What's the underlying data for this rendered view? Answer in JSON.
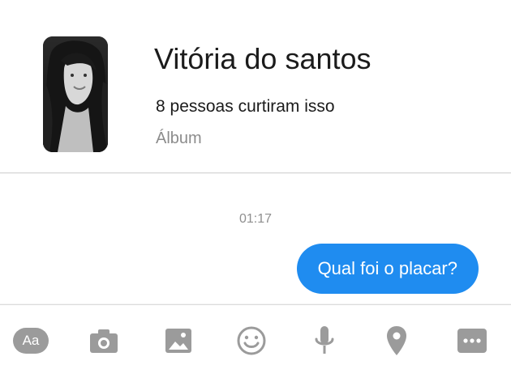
{
  "profile": {
    "name": "Vitória do santos",
    "likes": "8 pessoas curtiram isso",
    "type": "Álbum"
  },
  "conversation": {
    "timestamp": "01:17",
    "message": "Qual foi o placar?",
    "bubble_color": "#1f8cf0"
  },
  "composer": {
    "text_button_label": "Aa",
    "icons": [
      "text-format-icon",
      "camera-icon",
      "image-icon",
      "emoji-icon",
      "microphone-icon",
      "location-icon",
      "more-icon"
    ],
    "icon_color": "#9b9b9b"
  }
}
